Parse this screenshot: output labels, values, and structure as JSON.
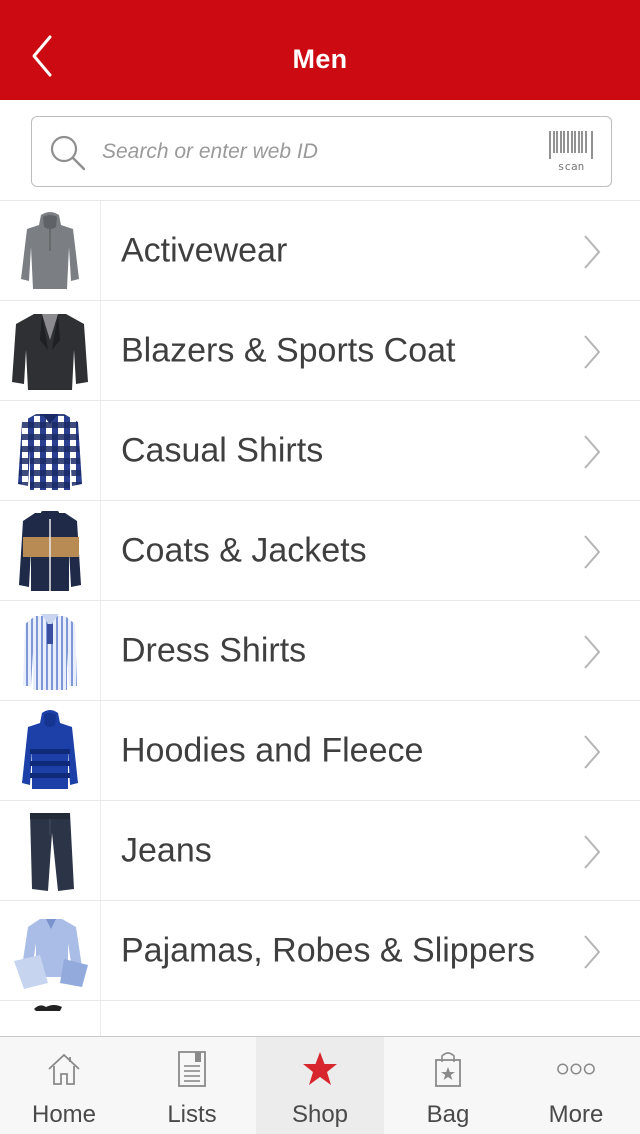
{
  "header": {
    "title": "Men",
    "background": "#cc0a12"
  },
  "search": {
    "placeholder": "Search or enter web ID",
    "scan_label": "scan"
  },
  "categories": [
    {
      "label": "Activewear",
      "icon": "hoodie-gray-thumbnail"
    },
    {
      "label": "Blazers & Sports Coat",
      "icon": "blazer-thumbnail"
    },
    {
      "label": "Casual Shirts",
      "icon": "plaid-shirt-thumbnail"
    },
    {
      "label": "Coats & Jackets",
      "icon": "puffer-jacket-thumbnail"
    },
    {
      "label": "Dress Shirts",
      "icon": "dress-shirt-thumbnail"
    },
    {
      "label": "Hoodies and Fleece",
      "icon": "blue-hoodie-thumbnail"
    },
    {
      "label": "Jeans",
      "icon": "jeans-thumbnail"
    },
    {
      "label": "Pajamas, Robes & Slippers",
      "icon": "pajamas-thumbnail"
    }
  ],
  "tabbar": {
    "tabs": [
      {
        "label": "Home",
        "icon": "home-icon"
      },
      {
        "label": "Lists",
        "icon": "list-icon"
      },
      {
        "label": "Shop",
        "icon": "star-icon",
        "active": true
      },
      {
        "label": "Bag",
        "icon": "bag-icon"
      },
      {
        "label": "More",
        "icon": "more-icon"
      }
    ],
    "active_color": "#d7262e"
  }
}
